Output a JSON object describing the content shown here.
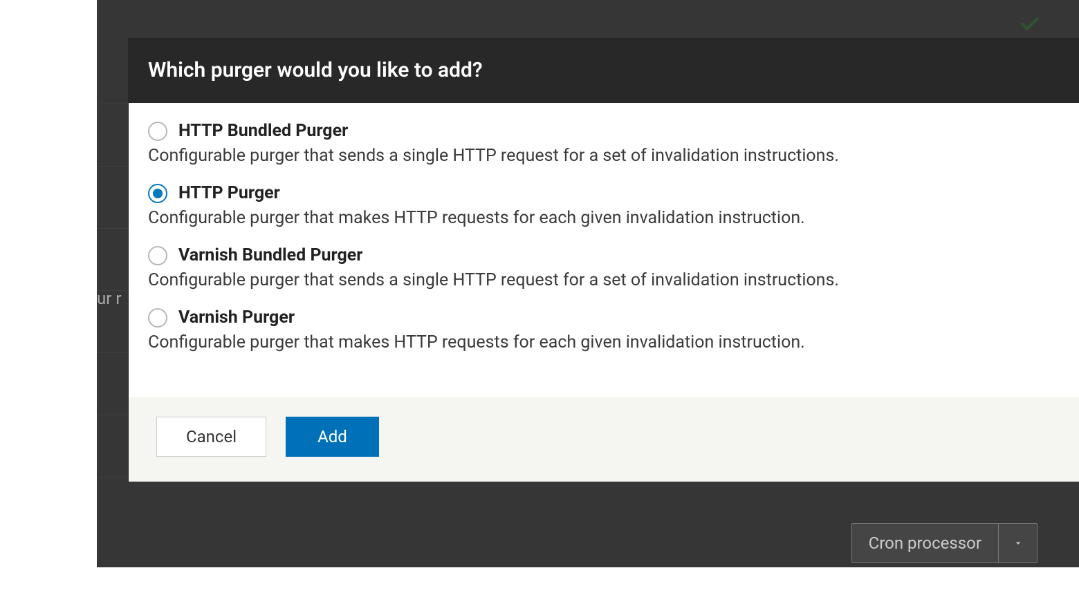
{
  "dialog": {
    "title": "Which purger would you like to add?",
    "options": [
      {
        "label": "HTTP Bundled Purger",
        "description": "Configurable purger that sends a single HTTP request for a set of invalidation instructions.",
        "selected": false
      },
      {
        "label": "HTTP Purger",
        "description": "Configurable purger that makes HTTP requests for each given invalidation instruction.",
        "selected": true
      },
      {
        "label": "Varnish Bundled Purger",
        "description": "Configurable purger that sends a single HTTP request for a set of invalidation instructions.",
        "selected": false
      },
      {
        "label": "Varnish Purger",
        "description": "Configurable purger that makes HTTP requests for each given invalidation instruction.",
        "selected": false
      }
    ],
    "buttons": {
      "cancel": "Cancel",
      "add": "Add"
    }
  },
  "background": {
    "partial_text": "ur r",
    "dropdown_label": "Cron processor"
  }
}
